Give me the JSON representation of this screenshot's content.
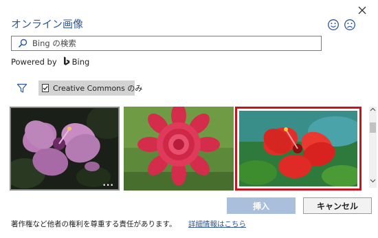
{
  "dialog": {
    "title": "オンライン画像",
    "close_icon": "close-icon",
    "feedback_icons": [
      "smile-icon",
      "frown-icon"
    ]
  },
  "search": {
    "placeholder": "Bing の検索",
    "value": "",
    "icon": "search-icon"
  },
  "powered_by": {
    "label": "Powered by",
    "brand": "Bing",
    "icon": "bing-logo"
  },
  "filters": {
    "icon": "filter-icon",
    "creative_commons": {
      "label": "Creative Commons のみ",
      "checked": true
    }
  },
  "results": [
    {
      "subject": "purple hibiscus",
      "selected": false,
      "has_more_menu": true,
      "more_glyph": "..."
    },
    {
      "subject": "red dahlia",
      "selected": false,
      "has_more_menu": false
    },
    {
      "subject": "red hibiscus",
      "selected": true,
      "has_more_menu": false
    }
  ],
  "buttons": {
    "insert": "挿入",
    "cancel": "キャンセル"
  },
  "footer": {
    "note": "著作権など他者の権利を尊重する責任があります。",
    "link": "詳細情報はこちら"
  },
  "colors": {
    "accent": "#2b579a",
    "selection_border": "#c7131b",
    "insert_disabled": "#a9bfdc",
    "chip_bg": "#d3d3d3"
  }
}
